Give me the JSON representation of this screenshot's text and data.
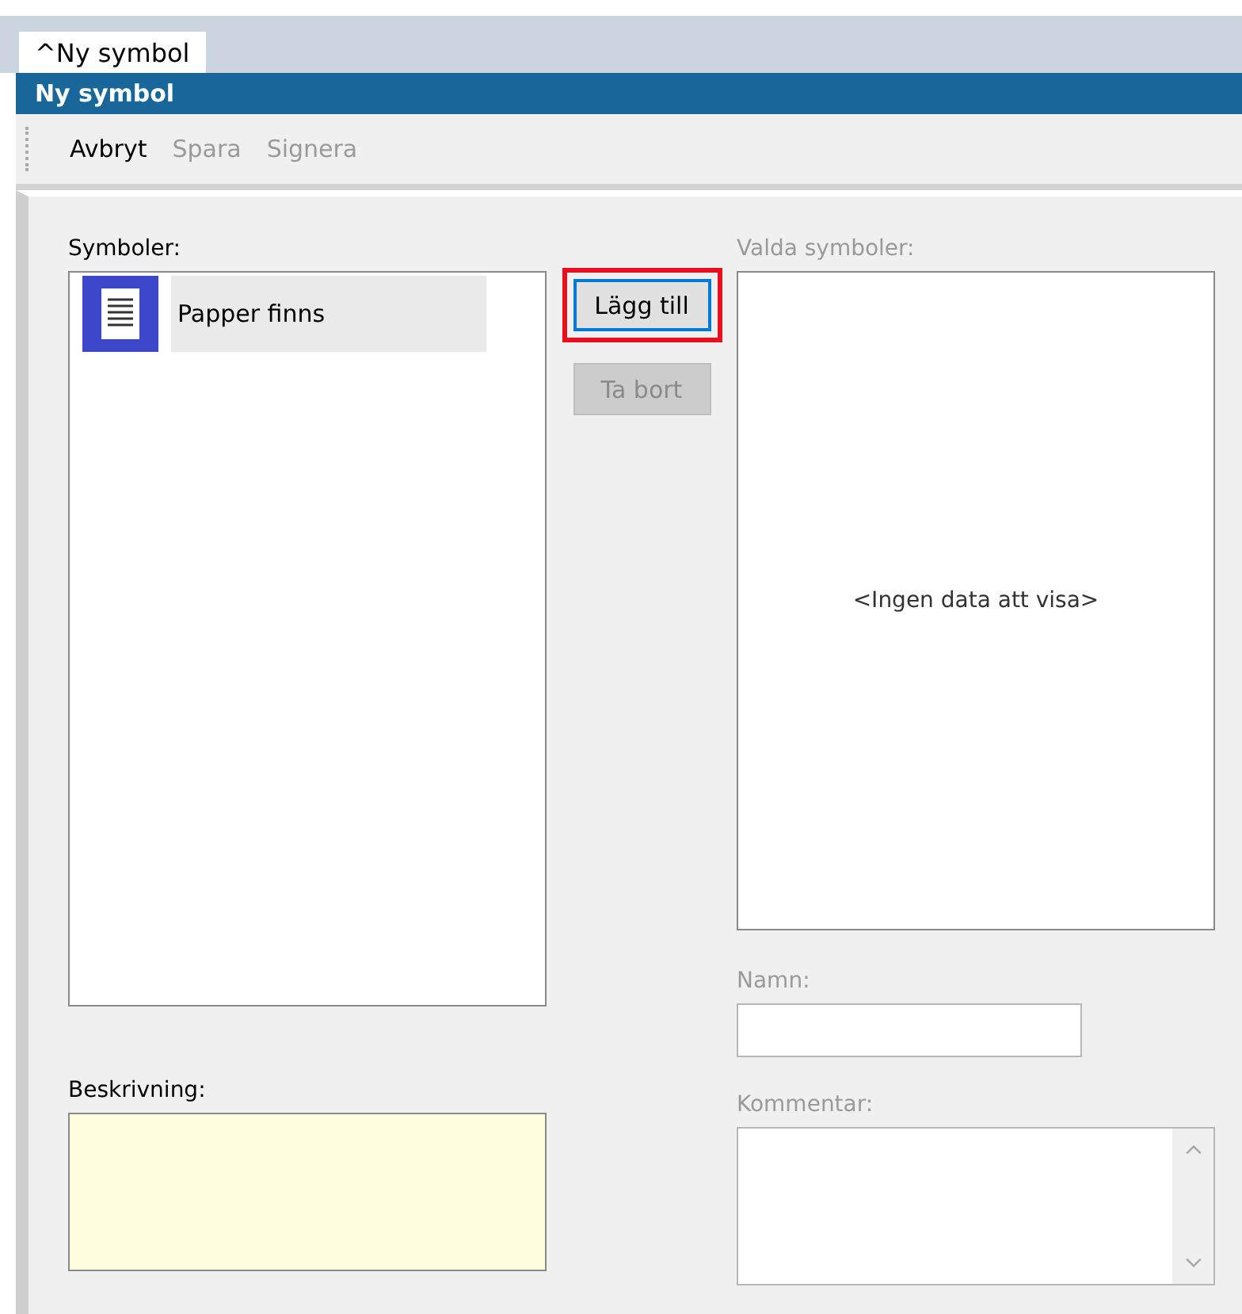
{
  "tab": {
    "label": "^Ny symbol",
    "selected": true
  },
  "window": {
    "title": "Ny symbol"
  },
  "toolbar": [
    {
      "label": "Avbryt",
      "disabled": false
    },
    {
      "label": "Spara",
      "disabled": true
    },
    {
      "label": "Signera",
      "disabled": true
    }
  ],
  "symbols": {
    "label": "Symboler:",
    "disabled": false,
    "items": [
      {
        "label": "Papper finns",
        "selected": true
      }
    ]
  },
  "buttons": [
    {
      "label": "Lägg till",
      "disabled": false,
      "highlighted": true
    },
    {
      "label": "Ta bort",
      "disabled": true,
      "highlighted": false
    }
  ],
  "selected_symbols": {
    "label": "Valda symboler:",
    "disabled": true,
    "empty_text": "<Ingen data att visa>"
  },
  "name": {
    "label": "Namn:",
    "disabled": true
  },
  "description": {
    "label": "Beskrivning:",
    "disabled": false
  },
  "comment": {
    "label": "Kommentar:",
    "disabled": true
  }
}
